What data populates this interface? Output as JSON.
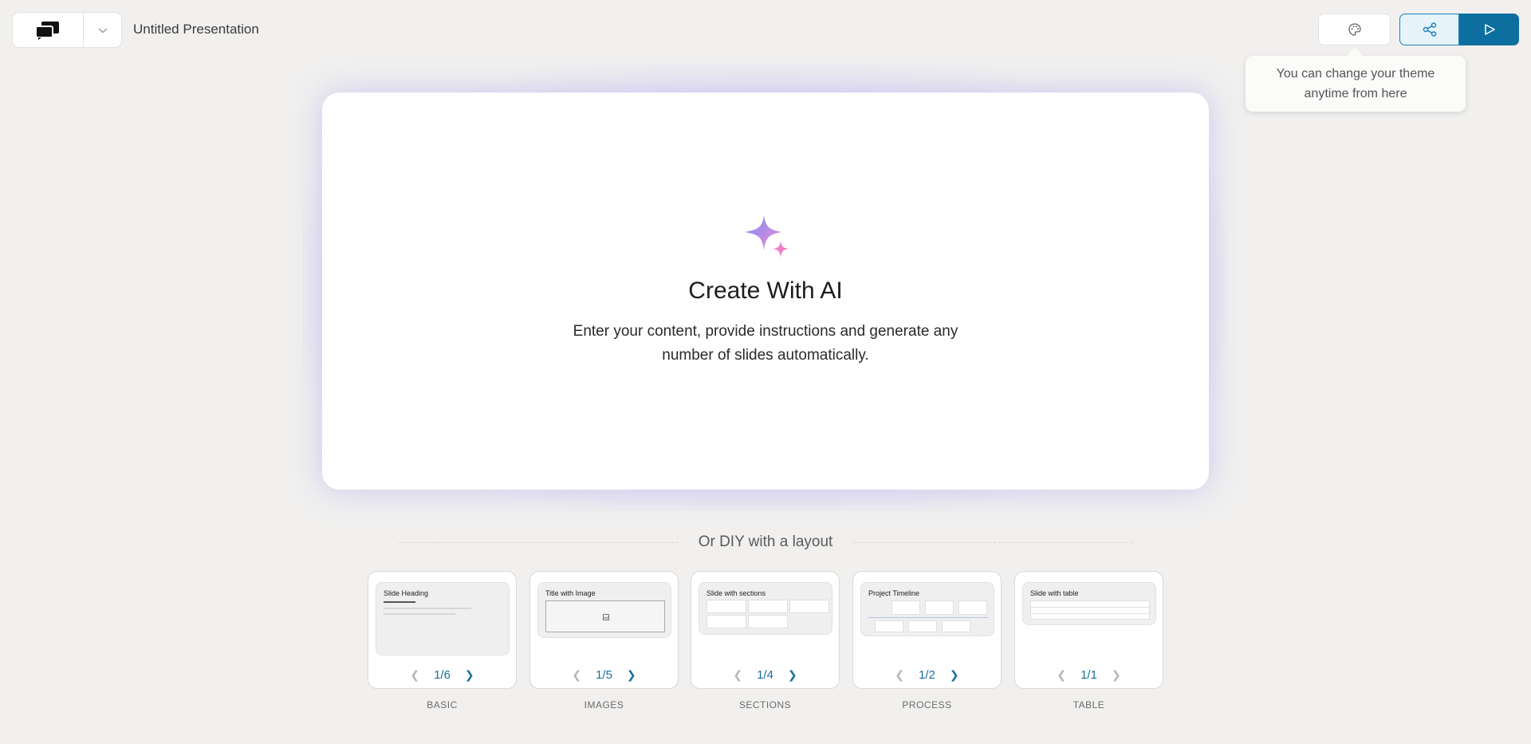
{
  "header": {
    "title": "Untitled Presentation",
    "logo_icon": "chat-bubbles-icon",
    "dropdown_icon": "chevron-down-icon",
    "theme_icon": "palette-icon",
    "share_icon": "share-icon",
    "present_icon": "play-icon"
  },
  "tooltip": {
    "text": "You can change your theme anytime from here"
  },
  "ai_card": {
    "icon": "sparkle-icon",
    "title": "Create With AI",
    "description_line1": "Enter your content, provide instructions and generate any",
    "description_line2": "number of slides automatically."
  },
  "diy": {
    "label": "Or DIY with a layout"
  },
  "layouts": [
    {
      "category": "BASIC",
      "preview_title": "Slide Heading",
      "page": "1/6"
    },
    {
      "category": "IMAGES",
      "preview_title": "Title with Image",
      "page": "1/5"
    },
    {
      "category": "SECTIONS",
      "preview_title": "Slide with sections",
      "page": "1/4"
    },
    {
      "category": "PROCESS",
      "preview_title": "Project Timeline",
      "page": "1/2"
    },
    {
      "category": "TABLE",
      "preview_title": "Slide with table",
      "page": "1/1"
    }
  ],
  "colors": {
    "background": "#f1f0ef",
    "accent": "#0d6fa0",
    "share_bg": "#e6f3fb"
  }
}
